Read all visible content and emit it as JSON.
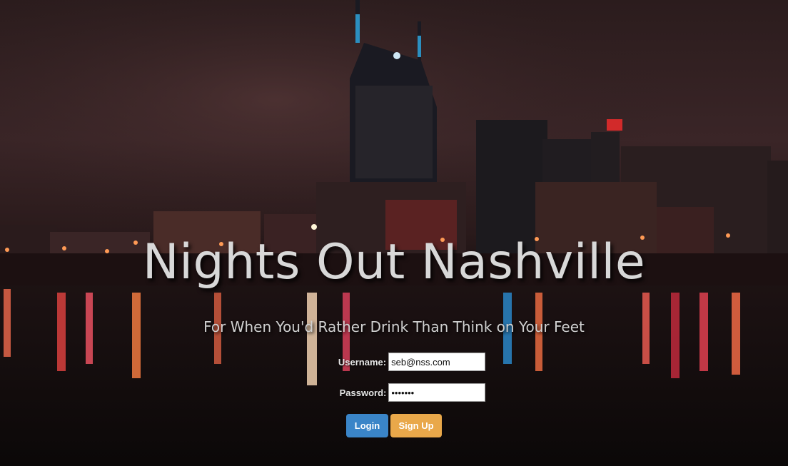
{
  "hero": {
    "title": "Nights Out Nashville",
    "subtitle": "For When You'd Rather Drink Than Think on Your Feet"
  },
  "form": {
    "username_label": "Username:",
    "username_value": "seb@nss.com",
    "password_label": "Password:",
    "password_value": "•••••••",
    "login_label": "Login",
    "signup_label": "Sign Up"
  },
  "colors": {
    "login_button": "#3a85c8",
    "signup_button": "#e9a84a",
    "title_text": "#d8d8d8"
  }
}
